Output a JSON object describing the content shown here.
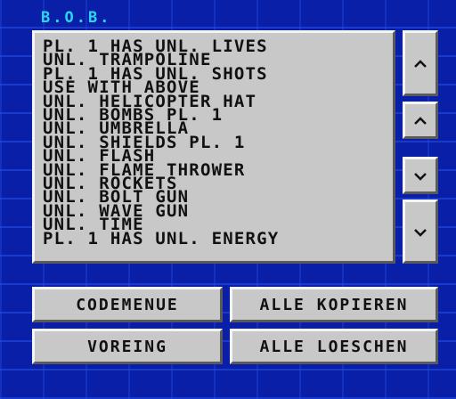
{
  "title": "B.O.B.",
  "cheats": [
    "PL. 1 HAS UNL. LIVES",
    "UNL. TRAMPOLINE",
    "PL. 1 HAS UNL. SHOTS",
    "USE WITH ABOVE",
    "UNL. HELICOPTER HAT",
    "UNL. BOMBS PL. 1",
    "UNL. UMBRELLA",
    "UNL. SHIELDS PL. 1",
    "UNL. FLASH",
    "UNL. FLAME THROWER",
    "UNL. ROCKETS",
    "UNL. BOLT GUN",
    "UNL. WAVE GUN",
    "UNL. TIME",
    "PL. 1 HAS UNL. ENERGY"
  ],
  "scroll_buttons": {
    "page_up_icon": "double-up-chevron",
    "line_up_icon": "up-chevron",
    "line_down_icon": "down-chevron",
    "page_down_icon": "double-down-chevron"
  },
  "buttons": {
    "codemenue": "CODEMENUE",
    "alle_kopieren": "ALLE KOPIEREN",
    "voreing": "VOREING",
    "alle_loeschen": "ALLE LOESCHEN"
  },
  "colors": {
    "background": "#0a1fa8",
    "title": "#2ad6f0",
    "panel": "#c8c8c8",
    "text": "#111111"
  }
}
